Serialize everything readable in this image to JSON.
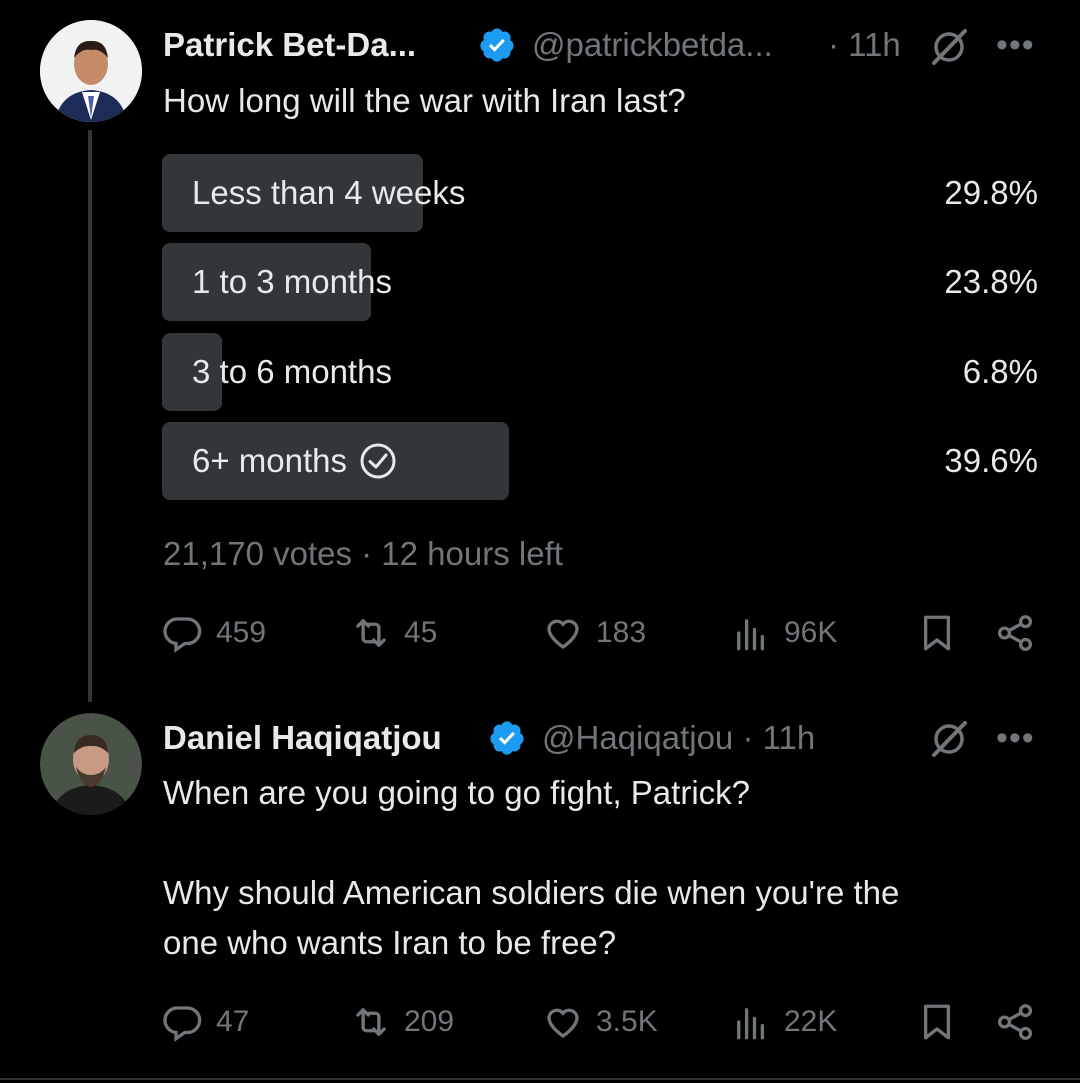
{
  "post": {
    "author_name": "Patrick Bet-Da...",
    "handle": "@patrickbetda...",
    "time": "· 11h",
    "text": "How long will the war with Iran last?",
    "poll": {
      "options": [
        {
          "label": "Less than 4 weeks",
          "percent": "29.8%",
          "fill": 0.298,
          "selected": false
        },
        {
          "label": "1 to 3 months",
          "percent": "23.8%",
          "fill": 0.238,
          "selected": false
        },
        {
          "label": "3 to 6 months",
          "percent": "6.8%",
          "fill": 0.068,
          "selected": false
        },
        {
          "label": "6+ months",
          "percent": "39.6%",
          "fill": 0.396,
          "selected": true
        }
      ],
      "summary": "21,170 votes · 12 hours left"
    },
    "actions": {
      "replies": "459",
      "reposts": "45",
      "likes": "183",
      "views": "96K"
    }
  },
  "reply": {
    "author_name": "Daniel Haqiqatjou",
    "handle": "@Haqiqatjou · 11h",
    "text_line1": "When are you going to go fight, Patrick?",
    "text_line2": "Why should American soldiers die when you're the",
    "text_line3": "one who wants Iran to be free?",
    "actions": {
      "replies": "47",
      "reposts": "209",
      "likes": "3.5K",
      "views": "22K"
    }
  },
  "icons": {
    "more": "•••",
    "verified_color": "#1d9bf0"
  }
}
